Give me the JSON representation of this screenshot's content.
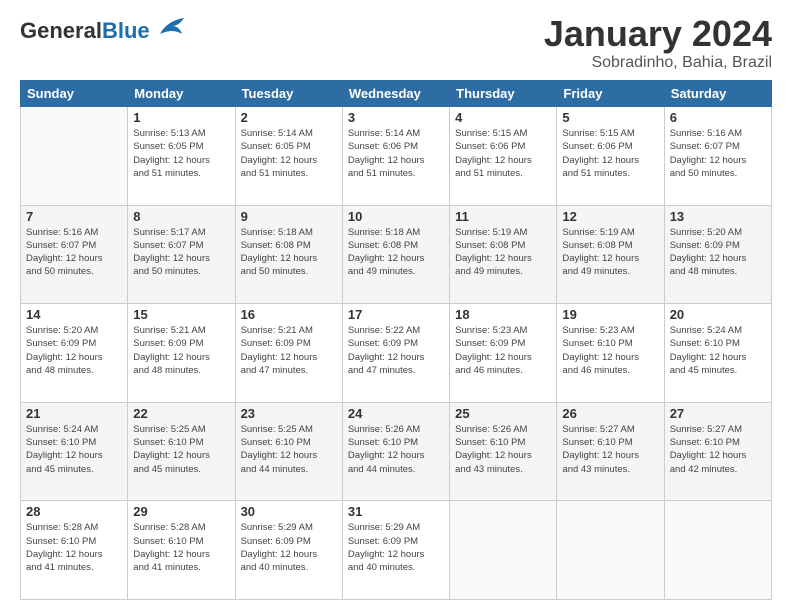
{
  "header": {
    "logo_general": "General",
    "logo_blue": "Blue",
    "month_title": "January 2024",
    "subtitle": "Sobradinho, Bahia, Brazil"
  },
  "weekdays": [
    "Sunday",
    "Monday",
    "Tuesday",
    "Wednesday",
    "Thursday",
    "Friday",
    "Saturday"
  ],
  "weeks": [
    [
      {
        "day": "",
        "info": ""
      },
      {
        "day": "1",
        "info": "Sunrise: 5:13 AM\nSunset: 6:05 PM\nDaylight: 12 hours\nand 51 minutes."
      },
      {
        "day": "2",
        "info": "Sunrise: 5:14 AM\nSunset: 6:05 PM\nDaylight: 12 hours\nand 51 minutes."
      },
      {
        "day": "3",
        "info": "Sunrise: 5:14 AM\nSunset: 6:06 PM\nDaylight: 12 hours\nand 51 minutes."
      },
      {
        "day": "4",
        "info": "Sunrise: 5:15 AM\nSunset: 6:06 PM\nDaylight: 12 hours\nand 51 minutes."
      },
      {
        "day": "5",
        "info": "Sunrise: 5:15 AM\nSunset: 6:06 PM\nDaylight: 12 hours\nand 51 minutes."
      },
      {
        "day": "6",
        "info": "Sunrise: 5:16 AM\nSunset: 6:07 PM\nDaylight: 12 hours\nand 50 minutes."
      }
    ],
    [
      {
        "day": "7",
        "info": "Sunrise: 5:16 AM\nSunset: 6:07 PM\nDaylight: 12 hours\nand 50 minutes."
      },
      {
        "day": "8",
        "info": "Sunrise: 5:17 AM\nSunset: 6:07 PM\nDaylight: 12 hours\nand 50 minutes."
      },
      {
        "day": "9",
        "info": "Sunrise: 5:18 AM\nSunset: 6:08 PM\nDaylight: 12 hours\nand 50 minutes."
      },
      {
        "day": "10",
        "info": "Sunrise: 5:18 AM\nSunset: 6:08 PM\nDaylight: 12 hours\nand 49 minutes."
      },
      {
        "day": "11",
        "info": "Sunrise: 5:19 AM\nSunset: 6:08 PM\nDaylight: 12 hours\nand 49 minutes."
      },
      {
        "day": "12",
        "info": "Sunrise: 5:19 AM\nSunset: 6:08 PM\nDaylight: 12 hours\nand 49 minutes."
      },
      {
        "day": "13",
        "info": "Sunrise: 5:20 AM\nSunset: 6:09 PM\nDaylight: 12 hours\nand 48 minutes."
      }
    ],
    [
      {
        "day": "14",
        "info": "Sunrise: 5:20 AM\nSunset: 6:09 PM\nDaylight: 12 hours\nand 48 minutes."
      },
      {
        "day": "15",
        "info": "Sunrise: 5:21 AM\nSunset: 6:09 PM\nDaylight: 12 hours\nand 48 minutes."
      },
      {
        "day": "16",
        "info": "Sunrise: 5:21 AM\nSunset: 6:09 PM\nDaylight: 12 hours\nand 47 minutes."
      },
      {
        "day": "17",
        "info": "Sunrise: 5:22 AM\nSunset: 6:09 PM\nDaylight: 12 hours\nand 47 minutes."
      },
      {
        "day": "18",
        "info": "Sunrise: 5:23 AM\nSunset: 6:09 PM\nDaylight: 12 hours\nand 46 minutes."
      },
      {
        "day": "19",
        "info": "Sunrise: 5:23 AM\nSunset: 6:10 PM\nDaylight: 12 hours\nand 46 minutes."
      },
      {
        "day": "20",
        "info": "Sunrise: 5:24 AM\nSunset: 6:10 PM\nDaylight: 12 hours\nand 45 minutes."
      }
    ],
    [
      {
        "day": "21",
        "info": "Sunrise: 5:24 AM\nSunset: 6:10 PM\nDaylight: 12 hours\nand 45 minutes."
      },
      {
        "day": "22",
        "info": "Sunrise: 5:25 AM\nSunset: 6:10 PM\nDaylight: 12 hours\nand 45 minutes."
      },
      {
        "day": "23",
        "info": "Sunrise: 5:25 AM\nSunset: 6:10 PM\nDaylight: 12 hours\nand 44 minutes."
      },
      {
        "day": "24",
        "info": "Sunrise: 5:26 AM\nSunset: 6:10 PM\nDaylight: 12 hours\nand 44 minutes."
      },
      {
        "day": "25",
        "info": "Sunrise: 5:26 AM\nSunset: 6:10 PM\nDaylight: 12 hours\nand 43 minutes."
      },
      {
        "day": "26",
        "info": "Sunrise: 5:27 AM\nSunset: 6:10 PM\nDaylight: 12 hours\nand 43 minutes."
      },
      {
        "day": "27",
        "info": "Sunrise: 5:27 AM\nSunset: 6:10 PM\nDaylight: 12 hours\nand 42 minutes."
      }
    ],
    [
      {
        "day": "28",
        "info": "Sunrise: 5:28 AM\nSunset: 6:10 PM\nDaylight: 12 hours\nand 41 minutes."
      },
      {
        "day": "29",
        "info": "Sunrise: 5:28 AM\nSunset: 6:10 PM\nDaylight: 12 hours\nand 41 minutes."
      },
      {
        "day": "30",
        "info": "Sunrise: 5:29 AM\nSunset: 6:09 PM\nDaylight: 12 hours\nand 40 minutes."
      },
      {
        "day": "31",
        "info": "Sunrise: 5:29 AM\nSunset: 6:09 PM\nDaylight: 12 hours\nand 40 minutes."
      },
      {
        "day": "",
        "info": ""
      },
      {
        "day": "",
        "info": ""
      },
      {
        "day": "",
        "info": ""
      }
    ]
  ]
}
